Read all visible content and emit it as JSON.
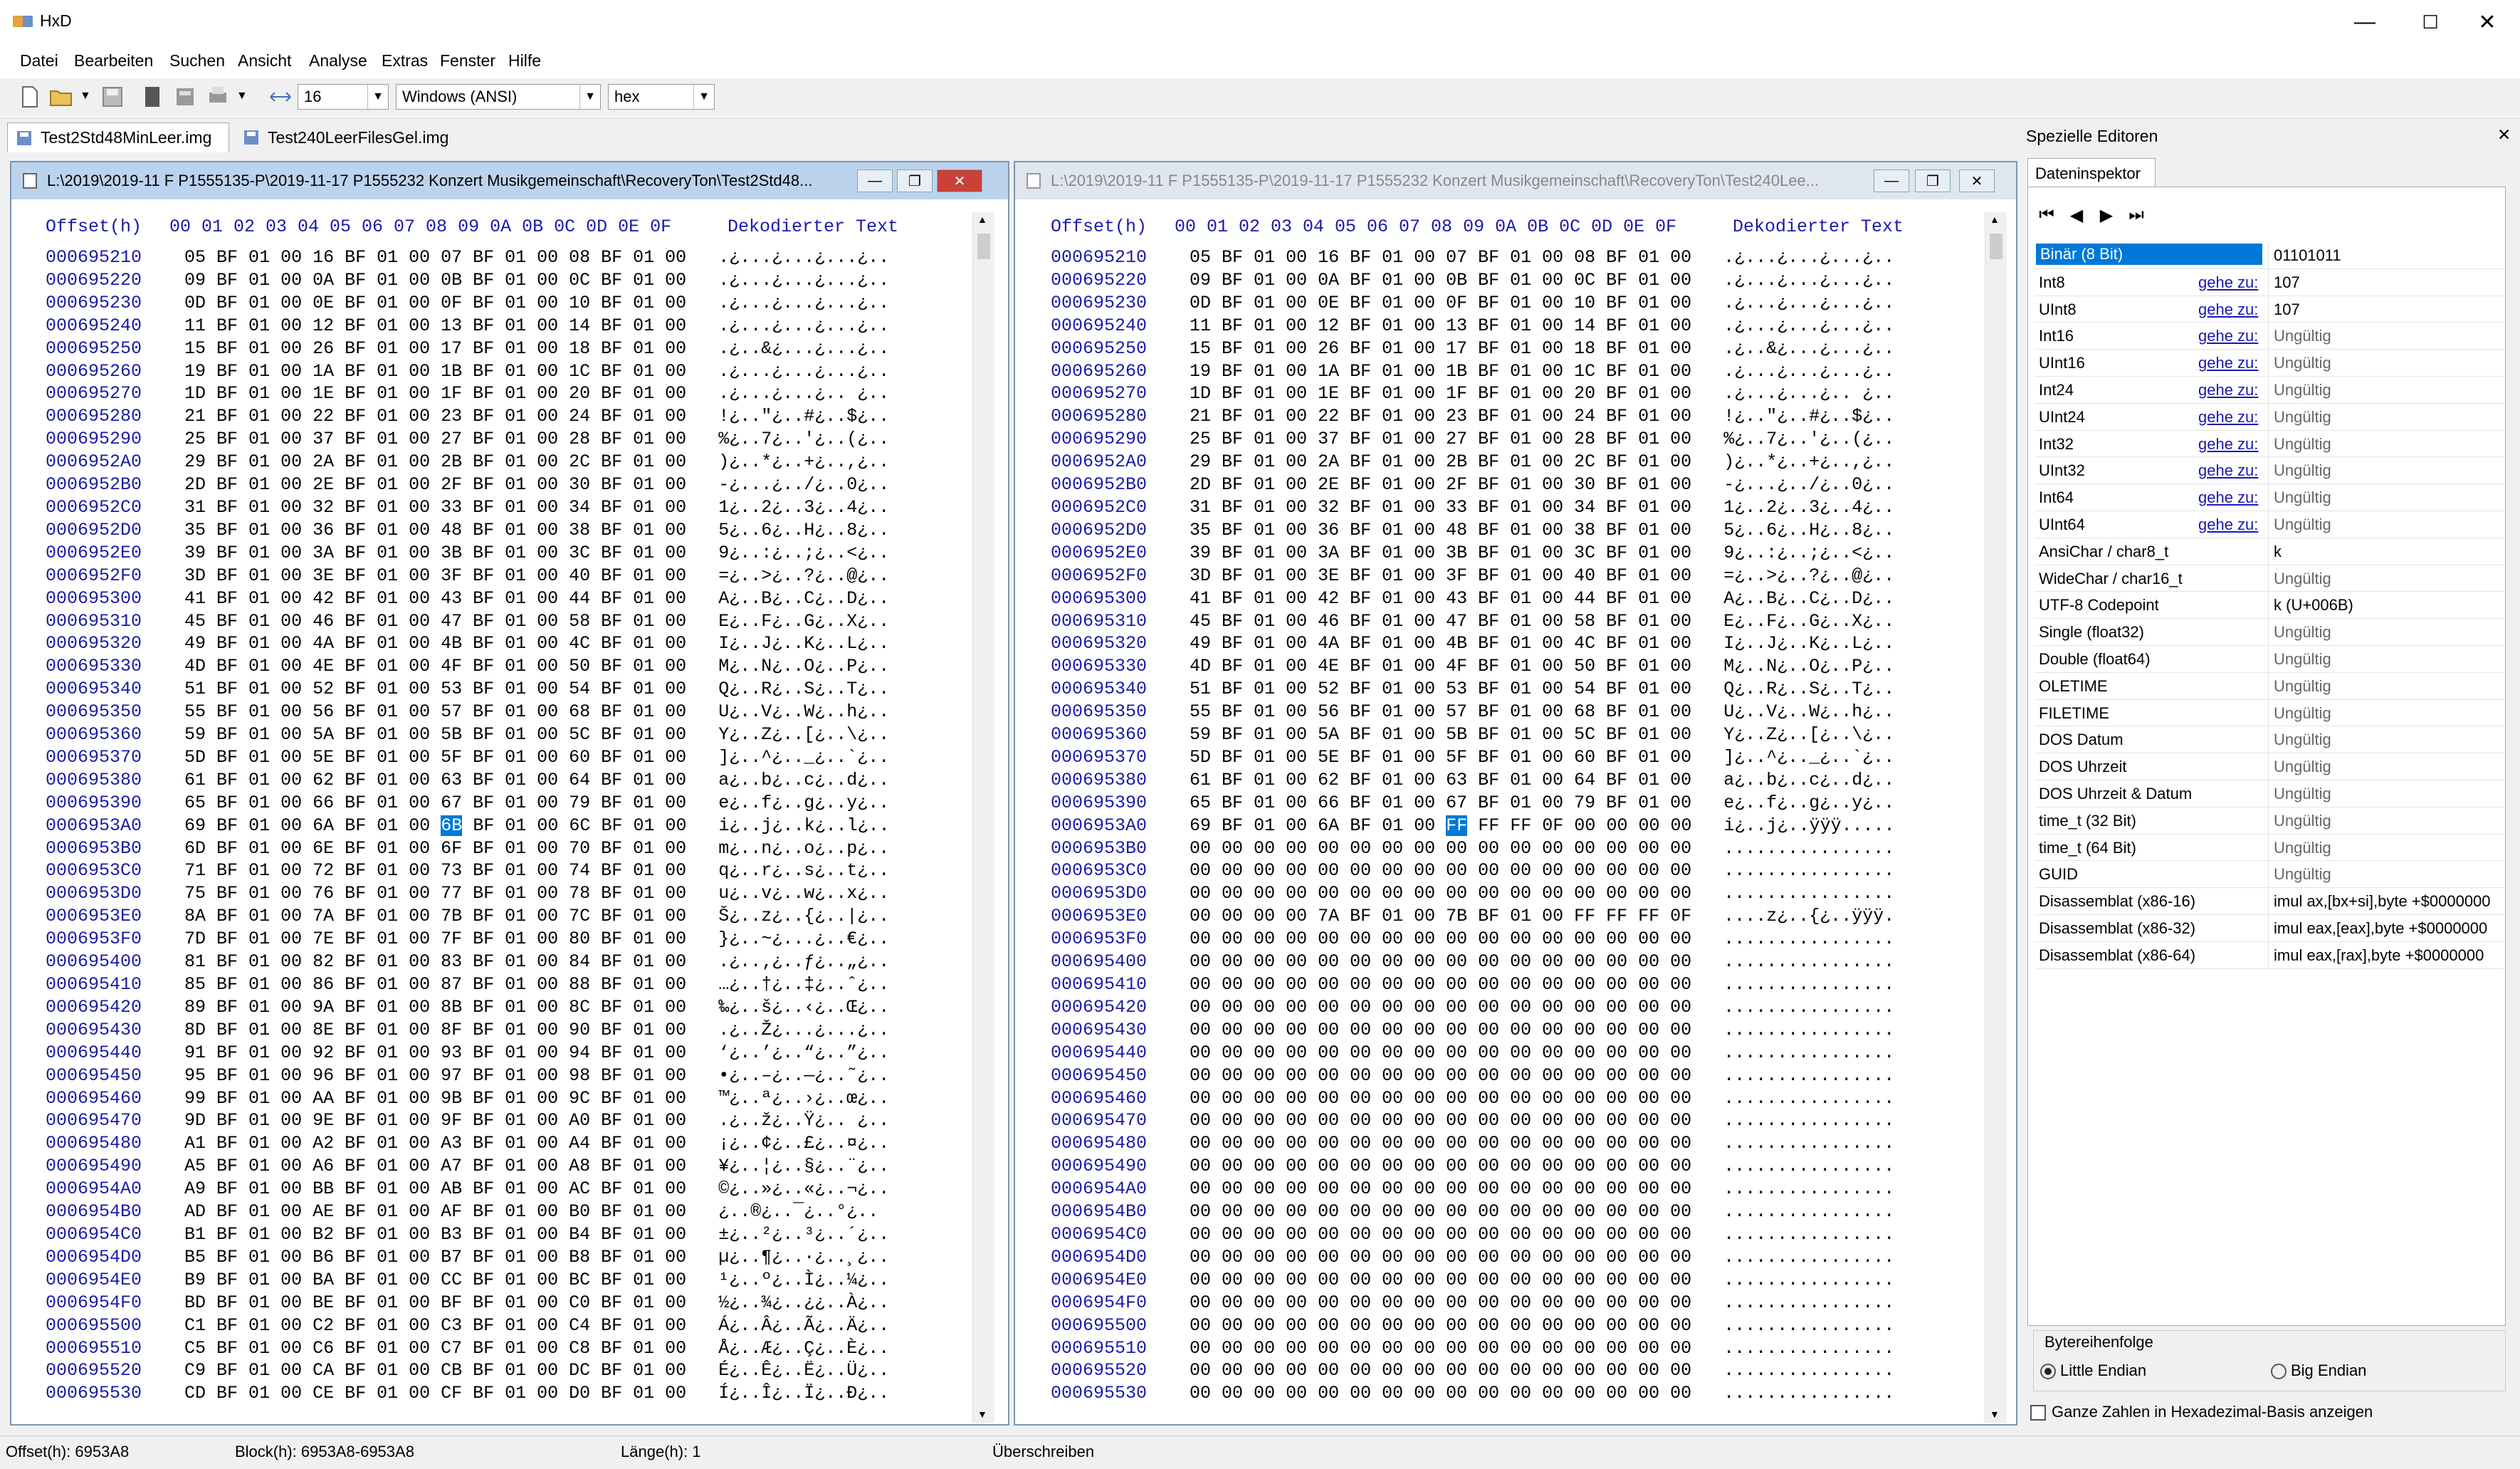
{
  "app": {
    "title": "HxD"
  },
  "window_controls": {
    "minimize": "—",
    "maximize": "☐",
    "close": "✕"
  },
  "menu": [
    "Datei",
    "Bearbeiten",
    "Suchen",
    "Ansicht",
    "Analyse",
    "Extras",
    "Fenster",
    "Hilfe"
  ],
  "toolbar": {
    "bytes_per_row": "16",
    "charset": "Windows (ANSI)",
    "offset_base": "hex"
  },
  "file_tabs": [
    {
      "label": "Test2Std48MinLeer.img",
      "active": true
    },
    {
      "label": "Test240LeerFilesGel.img",
      "active": false
    }
  ],
  "editors": [
    {
      "title": "L:\\2019\\2019-11 F P1555135-P\\2019-11-17 P1555232 Konzert Musikgemeinschaft\\RecoveryTon\\Test2Std48...",
      "header_offset": "Offset(h)",
      "header_cols": "00 01 02 03 04 05 06 07 08 09 0A 0B 0C 0D 0E 0F",
      "header_text": "Dekodierter Text",
      "rows": [
        [
          "000695210",
          "05 BF 01 00 16 BF 01 00 07 BF 01 00 08 BF 01 00",
          ".¿...¿...¿...¿.."
        ],
        [
          "000695220",
          "09 BF 01 00 0A BF 01 00 0B BF 01 00 0C BF 01 00",
          ".¿...¿...¿...¿.."
        ],
        [
          "000695230",
          "0D BF 01 00 0E BF 01 00 0F BF 01 00 10 BF 01 00",
          ".¿...¿...¿...¿.."
        ],
        [
          "000695240",
          "11 BF 01 00 12 BF 01 00 13 BF 01 00 14 BF 01 00",
          ".¿...¿...¿...¿.."
        ],
        [
          "000695250",
          "15 BF 01 00 26 BF 01 00 17 BF 01 00 18 BF 01 00",
          ".¿..&¿...¿...¿.."
        ],
        [
          "000695260",
          "19 BF 01 00 1A BF 01 00 1B BF 01 00 1C BF 01 00",
          ".¿...¿...¿...¿.."
        ],
        [
          "000695270",
          "1D BF 01 00 1E BF 01 00 1F BF 01 00 20 BF 01 00",
          ".¿...¿...¿.. ¿.."
        ],
        [
          "000695280",
          "21 BF 01 00 22 BF 01 00 23 BF 01 00 24 BF 01 00",
          "!¿..\"¿..#¿..$¿.."
        ],
        [
          "000695290",
          "25 BF 01 00 37 BF 01 00 27 BF 01 00 28 BF 01 00",
          "%¿..7¿..'¿..(¿.."
        ],
        [
          "0006952A0",
          "29 BF 01 00 2A BF 01 00 2B BF 01 00 2C BF 01 00",
          ")¿..*¿..+¿..,¿.."
        ],
        [
          "0006952B0",
          "2D BF 01 00 2E BF 01 00 2F BF 01 00 30 BF 01 00",
          "-¿...¿../¿..0¿.."
        ],
        [
          "0006952C0",
          "31 BF 01 00 32 BF 01 00 33 BF 01 00 34 BF 01 00",
          "1¿..2¿..3¿..4¿.."
        ],
        [
          "0006952D0",
          "35 BF 01 00 36 BF 01 00 48 BF 01 00 38 BF 01 00",
          "5¿..6¿..H¿..8¿.."
        ],
        [
          "0006952E0",
          "39 BF 01 00 3A BF 01 00 3B BF 01 00 3C BF 01 00",
          "9¿..:¿..;¿..<¿.."
        ],
        [
          "0006952F0",
          "3D BF 01 00 3E BF 01 00 3F BF 01 00 40 BF 01 00",
          "=¿..>¿..?¿..@¿.."
        ],
        [
          "000695300",
          "41 BF 01 00 42 BF 01 00 43 BF 01 00 44 BF 01 00",
          "A¿..B¿..C¿..D¿.."
        ],
        [
          "000695310",
          "45 BF 01 00 46 BF 01 00 47 BF 01 00 58 BF 01 00",
          "E¿..F¿..G¿..X¿.."
        ],
        [
          "000695320",
          "49 BF 01 00 4A BF 01 00 4B BF 01 00 4C BF 01 00",
          "I¿..J¿..K¿..L¿.."
        ],
        [
          "000695330",
          "4D BF 01 00 4E BF 01 00 4F BF 01 00 50 BF 01 00",
          "M¿..N¿..O¿..P¿.."
        ],
        [
          "000695340",
          "51 BF 01 00 52 BF 01 00 53 BF 01 00 54 BF 01 00",
          "Q¿..R¿..S¿..T¿.."
        ],
        [
          "000695350",
          "55 BF 01 00 56 BF 01 00 57 BF 01 00 68 BF 01 00",
          "U¿..V¿..W¿..h¿.."
        ],
        [
          "000695360",
          "59 BF 01 00 5A BF 01 00 5B BF 01 00 5C BF 01 00",
          "Y¿..Z¿..[¿..\\¿.."
        ],
        [
          "000695370",
          "5D BF 01 00 5E BF 01 00 5F BF 01 00 60 BF 01 00",
          "]¿..^¿.._¿..`¿.."
        ],
        [
          "000695380",
          "61 BF 01 00 62 BF 01 00 63 BF 01 00 64 BF 01 00",
          "a¿..b¿..c¿..d¿.."
        ],
        [
          "000695390",
          "65 BF 01 00 66 BF 01 00 67 BF 01 00 79 BF 01 00",
          "e¿..f¿..g¿..y¿.."
        ],
        [
          "0006953A0",
          "69 BF 01 00 6A BF 01 00 6B BF 01 00 6C BF 01 00",
          "i¿..j¿..k¿..l¿.."
        ],
        [
          "0006953B0",
          "6D BF 01 00 6E BF 01 00 6F BF 01 00 70 BF 01 00",
          "m¿..n¿..o¿..p¿.."
        ],
        [
          "0006953C0",
          "71 BF 01 00 72 BF 01 00 73 BF 01 00 74 BF 01 00",
          "q¿..r¿..s¿..t¿.."
        ],
        [
          "0006953D0",
          "75 BF 01 00 76 BF 01 00 77 BF 01 00 78 BF 01 00",
          "u¿..v¿..w¿..x¿.."
        ],
        [
          "0006953E0",
          "8A BF 01 00 7A BF 01 00 7B BF 01 00 7C BF 01 00",
          "Š¿..z¿..{¿..|¿.."
        ],
        [
          "0006953F0",
          "7D BF 01 00 7E BF 01 00 7F BF 01 00 80 BF 01 00",
          "}¿..~¿...¿..€¿.."
        ],
        [
          "000695400",
          "81 BF 01 00 82 BF 01 00 83 BF 01 00 84 BF 01 00",
          ".¿..‚¿..ƒ¿..„¿.."
        ],
        [
          "000695410",
          "85 BF 01 00 86 BF 01 00 87 BF 01 00 88 BF 01 00",
          "…¿..†¿..‡¿..ˆ¿.."
        ],
        [
          "000695420",
          "89 BF 01 00 9A BF 01 00 8B BF 01 00 8C BF 01 00",
          "‰¿..š¿..‹¿..Œ¿.."
        ],
        [
          "000695430",
          "8D BF 01 00 8E BF 01 00 8F BF 01 00 90 BF 01 00",
          ".¿..Ž¿...¿...¿.."
        ],
        [
          "000695440",
          "91 BF 01 00 92 BF 01 00 93 BF 01 00 94 BF 01 00",
          "‘¿..’¿..“¿..”¿.."
        ],
        [
          "000695450",
          "95 BF 01 00 96 BF 01 00 97 BF 01 00 98 BF 01 00",
          "•¿..–¿..—¿..˜¿.."
        ],
        [
          "000695460",
          "99 BF 01 00 AA BF 01 00 9B BF 01 00 9C BF 01 00",
          "™¿..ª¿..›¿..œ¿.."
        ],
        [
          "000695470",
          "9D BF 01 00 9E BF 01 00 9F BF 01 00 A0 BF 01 00",
          ".¿..ž¿..Ÿ¿.. ¿.."
        ],
        [
          "000695480",
          "A1 BF 01 00 A2 BF 01 00 A3 BF 01 00 A4 BF 01 00",
          "¡¿..¢¿..£¿..¤¿.."
        ],
        [
          "000695490",
          "A5 BF 01 00 A6 BF 01 00 A7 BF 01 00 A8 BF 01 00",
          "¥¿..¦¿..§¿..¨¿.."
        ],
        [
          "0006954A0",
          "A9 BF 01 00 BB BF 01 00 AB BF 01 00 AC BF 01 00",
          "©¿..»¿..«¿..¬¿.."
        ],
        [
          "0006954B0",
          "AD BF 01 00 AE BF 01 00 AF BF 01 00 B0 BF 01 00",
          "­¿..®¿..¯¿..°¿.."
        ],
        [
          "0006954C0",
          "B1 BF 01 00 B2 BF 01 00 B3 BF 01 00 B4 BF 01 00",
          "±¿..²¿..³¿..´¿.."
        ],
        [
          "0006954D0",
          "B5 BF 01 00 B6 BF 01 00 B7 BF 01 00 B8 BF 01 00",
          "µ¿..¶¿..·¿..¸¿.."
        ],
        [
          "0006954E0",
          "B9 BF 01 00 BA BF 01 00 CC BF 01 00 BC BF 01 00",
          "¹¿..º¿..Ì¿..¼¿.."
        ],
        [
          "0006954F0",
          "BD BF 01 00 BE BF 01 00 BF BF 01 00 C0 BF 01 00",
          "½¿..¾¿..¿¿..À¿.."
        ],
        [
          "000695500",
          "C1 BF 01 00 C2 BF 01 00 C3 BF 01 00 C4 BF 01 00",
          "Á¿..Â¿..Ã¿..Ä¿.."
        ],
        [
          "000695510",
          "C5 BF 01 00 C6 BF 01 00 C7 BF 01 00 C8 BF 01 00",
          "Å¿..Æ¿..Ç¿..È¿.."
        ],
        [
          "000695520",
          "C9 BF 01 00 CA BF 01 00 CB BF 01 00 DC BF 01 00",
          "É¿..Ê¿..Ë¿..Ü¿.."
        ],
        [
          "000695530",
          "CD BF 01 00 CE BF 01 00 CF BF 01 00 D0 BF 01 00",
          "Í¿..Î¿..Ï¿..Ð¿.."
        ]
      ]
    },
    {
      "title": "L:\\2019\\2019-11 F P1555135-P\\2019-11-17 P1555232 Konzert Musikgemeinschaft\\RecoveryTon\\Test240Lee...",
      "header_offset": "Offset(h)",
      "header_cols": "00 01 02 03 04 05 06 07 08 09 0A 0B 0C 0D 0E 0F",
      "header_text": "Dekodierter Text",
      "rows": [
        [
          "000695210",
          "05 BF 01 00 16 BF 01 00 07 BF 01 00 08 BF 01 00",
          ".¿...¿...¿...¿.."
        ],
        [
          "000695220",
          "09 BF 01 00 0A BF 01 00 0B BF 01 00 0C BF 01 00",
          ".¿...¿...¿...¿.."
        ],
        [
          "000695230",
          "0D BF 01 00 0E BF 01 00 0F BF 01 00 10 BF 01 00",
          ".¿...¿...¿...¿.."
        ],
        [
          "000695240",
          "11 BF 01 00 12 BF 01 00 13 BF 01 00 14 BF 01 00",
          ".¿...¿...¿...¿.."
        ],
        [
          "000695250",
          "15 BF 01 00 26 BF 01 00 17 BF 01 00 18 BF 01 00",
          ".¿..&¿...¿...¿.."
        ],
        [
          "000695260",
          "19 BF 01 00 1A BF 01 00 1B BF 01 00 1C BF 01 00",
          ".¿...¿...¿...¿.."
        ],
        [
          "000695270",
          "1D BF 01 00 1E BF 01 00 1F BF 01 00 20 BF 01 00",
          ".¿...¿...¿.. ¿.."
        ],
        [
          "000695280",
          "21 BF 01 00 22 BF 01 00 23 BF 01 00 24 BF 01 00",
          "!¿..\"¿..#¿..$¿.."
        ],
        [
          "000695290",
          "25 BF 01 00 37 BF 01 00 27 BF 01 00 28 BF 01 00",
          "%¿..7¿..'¿..(¿.."
        ],
        [
          "0006952A0",
          "29 BF 01 00 2A BF 01 00 2B BF 01 00 2C BF 01 00",
          ")¿..*¿..+¿..,¿.."
        ],
        [
          "0006952B0",
          "2D BF 01 00 2E BF 01 00 2F BF 01 00 30 BF 01 00",
          "-¿...¿../¿..0¿.."
        ],
        [
          "0006952C0",
          "31 BF 01 00 32 BF 01 00 33 BF 01 00 34 BF 01 00",
          "1¿..2¿..3¿..4¿.."
        ],
        [
          "0006952D0",
          "35 BF 01 00 36 BF 01 00 48 BF 01 00 38 BF 01 00",
          "5¿..6¿..H¿..8¿.."
        ],
        [
          "0006952E0",
          "39 BF 01 00 3A BF 01 00 3B BF 01 00 3C BF 01 00",
          "9¿..:¿..;¿..<¿.."
        ],
        [
          "0006952F0",
          "3D BF 01 00 3E BF 01 00 3F BF 01 00 40 BF 01 00",
          "=¿..>¿..?¿..@¿.."
        ],
        [
          "000695300",
          "41 BF 01 00 42 BF 01 00 43 BF 01 00 44 BF 01 00",
          "A¿..B¿..C¿..D¿.."
        ],
        [
          "000695310",
          "45 BF 01 00 46 BF 01 00 47 BF 01 00 58 BF 01 00",
          "E¿..F¿..G¿..X¿.."
        ],
        [
          "000695320",
          "49 BF 01 00 4A BF 01 00 4B BF 01 00 4C BF 01 00",
          "I¿..J¿..K¿..L¿.."
        ],
        [
          "000695330",
          "4D BF 01 00 4E BF 01 00 4F BF 01 00 50 BF 01 00",
          "M¿..N¿..O¿..P¿.."
        ],
        [
          "000695340",
          "51 BF 01 00 52 BF 01 00 53 BF 01 00 54 BF 01 00",
          "Q¿..R¿..S¿..T¿.."
        ],
        [
          "000695350",
          "55 BF 01 00 56 BF 01 00 57 BF 01 00 68 BF 01 00",
          "U¿..V¿..W¿..h¿.."
        ],
        [
          "000695360",
          "59 BF 01 00 5A BF 01 00 5B BF 01 00 5C BF 01 00",
          "Y¿..Z¿..[¿..\\¿.."
        ],
        [
          "000695370",
          "5D BF 01 00 5E BF 01 00 5F BF 01 00 60 BF 01 00",
          "]¿..^¿.._¿..`¿.."
        ],
        [
          "000695380",
          "61 BF 01 00 62 BF 01 00 63 BF 01 00 64 BF 01 00",
          "a¿..b¿..c¿..d¿.."
        ],
        [
          "000695390",
          "65 BF 01 00 66 BF 01 00 67 BF 01 00 79 BF 01 00",
          "e¿..f¿..g¿..y¿.."
        ],
        [
          "0006953A0",
          "69 BF 01 00 6A BF 01 00 FF FF FF 0F 00 00 00 00",
          "i¿..j¿..ÿÿÿ....."
        ],
        [
          "0006953B0",
          "00 00 00 00 00 00 00 00 00 00 00 00 00 00 00 00",
          "................"
        ],
        [
          "0006953C0",
          "00 00 00 00 00 00 00 00 00 00 00 00 00 00 00 00",
          "................"
        ],
        [
          "0006953D0",
          "00 00 00 00 00 00 00 00 00 00 00 00 00 00 00 00",
          "................"
        ],
        [
          "0006953E0",
          "00 00 00 00 7A BF 01 00 7B BF 01 00 FF FF FF 0F",
          "....z¿..{¿..ÿÿÿ."
        ],
        [
          "0006953F0",
          "00 00 00 00 00 00 00 00 00 00 00 00 00 00 00 00",
          "................"
        ],
        [
          "000695400",
          "00 00 00 00 00 00 00 00 00 00 00 00 00 00 00 00",
          "................"
        ],
        [
          "000695410",
          "00 00 00 00 00 00 00 00 00 00 00 00 00 00 00 00",
          "................"
        ],
        [
          "000695420",
          "00 00 00 00 00 00 00 00 00 00 00 00 00 00 00 00",
          "................"
        ],
        [
          "000695430",
          "00 00 00 00 00 00 00 00 00 00 00 00 00 00 00 00",
          "................"
        ],
        [
          "000695440",
          "00 00 00 00 00 00 00 00 00 00 00 00 00 00 00 00",
          "................"
        ],
        [
          "000695450",
          "00 00 00 00 00 00 00 00 00 00 00 00 00 00 00 00",
          "................"
        ],
        [
          "000695460",
          "00 00 00 00 00 00 00 00 00 00 00 00 00 00 00 00",
          "................"
        ],
        [
          "000695470",
          "00 00 00 00 00 00 00 00 00 00 00 00 00 00 00 00",
          "................"
        ],
        [
          "000695480",
          "00 00 00 00 00 00 00 00 00 00 00 00 00 00 00 00",
          "................"
        ],
        [
          "000695490",
          "00 00 00 00 00 00 00 00 00 00 00 00 00 00 00 00",
          "................"
        ],
        [
          "0006954A0",
          "00 00 00 00 00 00 00 00 00 00 00 00 00 00 00 00",
          "................"
        ],
        [
          "0006954B0",
          "00 00 00 00 00 00 00 00 00 00 00 00 00 00 00 00",
          "................"
        ],
        [
          "0006954C0",
          "00 00 00 00 00 00 00 00 00 00 00 00 00 00 00 00",
          "................"
        ],
        [
          "0006954D0",
          "00 00 00 00 00 00 00 00 00 00 00 00 00 00 00 00",
          "................"
        ],
        [
          "0006954E0",
          "00 00 00 00 00 00 00 00 00 00 00 00 00 00 00 00",
          "................"
        ],
        [
          "0006954F0",
          "00 00 00 00 00 00 00 00 00 00 00 00 00 00 00 00",
          "................"
        ],
        [
          "000695500",
          "00 00 00 00 00 00 00 00 00 00 00 00 00 00 00 00",
          "................"
        ],
        [
          "000695510",
          "00 00 00 00 00 00 00 00 00 00 00 00 00 00 00 00",
          "................"
        ],
        [
          "000695520",
          "00 00 00 00 00 00 00 00 00 00 00 00 00 00 00 00",
          "................"
        ],
        [
          "000695530",
          "00 00 00 00 00 00 00 00 00 00 00 00 00 00 00 00",
          "................"
        ]
      ]
    }
  ],
  "inspector": {
    "panel_title": "Spezielle Editoren",
    "panel_close": "✕",
    "tab_label": "Dateninspektor",
    "goto_label": "gehe zu:",
    "rows": [
      {
        "label": "Binär (8 Bit)",
        "goto": false,
        "value": "01101011",
        "selected": true
      },
      {
        "label": "Int8",
        "goto": true,
        "value": "107"
      },
      {
        "label": "UInt8",
        "goto": true,
        "value": "107"
      },
      {
        "label": "Int16",
        "goto": true,
        "value": "Ungültig"
      },
      {
        "label": "UInt16",
        "goto": true,
        "value": "Ungültig"
      },
      {
        "label": "Int24",
        "goto": true,
        "value": "Ungültig"
      },
      {
        "label": "UInt24",
        "goto": true,
        "value": "Ungültig"
      },
      {
        "label": "Int32",
        "goto": true,
        "value": "Ungültig"
      },
      {
        "label": "UInt32",
        "goto": true,
        "value": "Ungültig"
      },
      {
        "label": "Int64",
        "goto": true,
        "value": "Ungültig"
      },
      {
        "label": "UInt64",
        "goto": true,
        "value": "Ungültig"
      },
      {
        "label": "AnsiChar / char8_t",
        "goto": false,
        "value": "k"
      },
      {
        "label": "WideChar / char16_t",
        "goto": false,
        "value": "Ungültig"
      },
      {
        "label": "UTF-8 Codepoint",
        "goto": false,
        "value": "k (U+006B)"
      },
      {
        "label": "Single (float32)",
        "goto": false,
        "value": "Ungültig"
      },
      {
        "label": "Double (float64)",
        "goto": false,
        "value": "Ungültig"
      },
      {
        "label": "OLETIME",
        "goto": false,
        "value": "Ungültig"
      },
      {
        "label": "FILETIME",
        "goto": false,
        "value": "Ungültig"
      },
      {
        "label": "DOS Datum",
        "goto": false,
        "value": "Ungültig"
      },
      {
        "label": "DOS Uhrzeit",
        "goto": false,
        "value": "Ungültig"
      },
      {
        "label": "DOS Uhrzeit & Datum",
        "goto": false,
        "value": "Ungültig"
      },
      {
        "label": "time_t (32 Bit)",
        "goto": false,
        "value": "Ungültig"
      },
      {
        "label": "time_t (64 Bit)",
        "goto": false,
        "value": "Ungültig"
      },
      {
        "label": "GUID",
        "goto": false,
        "value": "Ungültig"
      },
      {
        "label": "Disassemblat (x86-16)",
        "goto": false,
        "value": "imul ax,[bx+si],byte +$0000000"
      },
      {
        "label": "Disassemblat (x86-32)",
        "goto": false,
        "value": "imul eax,[eax],byte +$0000000"
      },
      {
        "label": "Disassemblat (x86-64)",
        "goto": false,
        "value": "imul eax,[rax],byte +$0000000"
      }
    ],
    "byteorder_title": "Bytereihenfolge",
    "little_endian": "Little Endian",
    "big_endian": "Big Endian",
    "hex_checkbox": "Ganze Zahlen in Hexadezimal-Basis anzeigen"
  },
  "status": {
    "offset": "Offset(h): 6953A8",
    "block": "Block(h): 6953A8-6953A8",
    "length": "Länge(h): 1",
    "mode": "Überschreiben"
  },
  "colors": {
    "offset_blue": "#1a1aa8",
    "selection": "#0078d7",
    "active_title": "#bcd3ee"
  }
}
